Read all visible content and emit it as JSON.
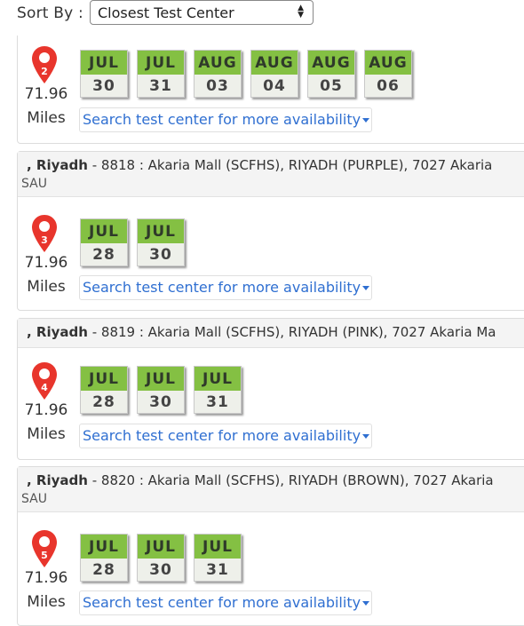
{
  "sort": {
    "label": "Sort By :",
    "selected": "Closest Test Center"
  },
  "pin_color": "#e8352c",
  "date_header_color": "#84c043",
  "results": [
    {
      "pin_number": "2",
      "distance": "71.96",
      "distance_unit": "Miles",
      "dates": [
        {
          "month": "JUL",
          "day": "30"
        },
        {
          "month": "JUL",
          "day": "31"
        },
        {
          "month": "AUG",
          "day": "03"
        },
        {
          "month": "AUG",
          "day": "04"
        },
        {
          "month": "AUG",
          "day": "05"
        },
        {
          "month": "AUG",
          "day": "06"
        }
      ],
      "more_label": "Search test center for more availability"
    },
    {
      "city": ", Riyadh",
      "center": "- 8818 : Akaria Mall (SCFHS), RIYADH (PURPLE), 7027 Akaria",
      "country": "SAU",
      "pin_number": "3",
      "distance": "71.96",
      "distance_unit": "Miles",
      "dates": [
        {
          "month": "JUL",
          "day": "28"
        },
        {
          "month": "JUL",
          "day": "30"
        }
      ],
      "more_label": "Search test center for more availability"
    },
    {
      "city": ", Riyadh",
      "center": "- 8819 : Akaria Mall (SCFHS), RIYADH (PINK), 7027 Akaria Ma",
      "pin_number": "4",
      "distance": "71.96",
      "distance_unit": "Miles",
      "dates": [
        {
          "month": "JUL",
          "day": "28"
        },
        {
          "month": "JUL",
          "day": "30"
        },
        {
          "month": "JUL",
          "day": "31"
        }
      ],
      "more_label": "Search test center for more availability"
    },
    {
      "city": ", Riyadh",
      "center": "- 8820 : Akaria Mall (SCFHS), RIYADH (BROWN), 7027 Akaria",
      "country": "SAU",
      "pin_number": "5",
      "distance": "71.96",
      "distance_unit": "Miles",
      "dates": [
        {
          "month": "JUL",
          "day": "28"
        },
        {
          "month": "JUL",
          "day": "30"
        },
        {
          "month": "JUL",
          "day": "31"
        }
      ],
      "more_label": "Search test center for more availability"
    }
  ]
}
